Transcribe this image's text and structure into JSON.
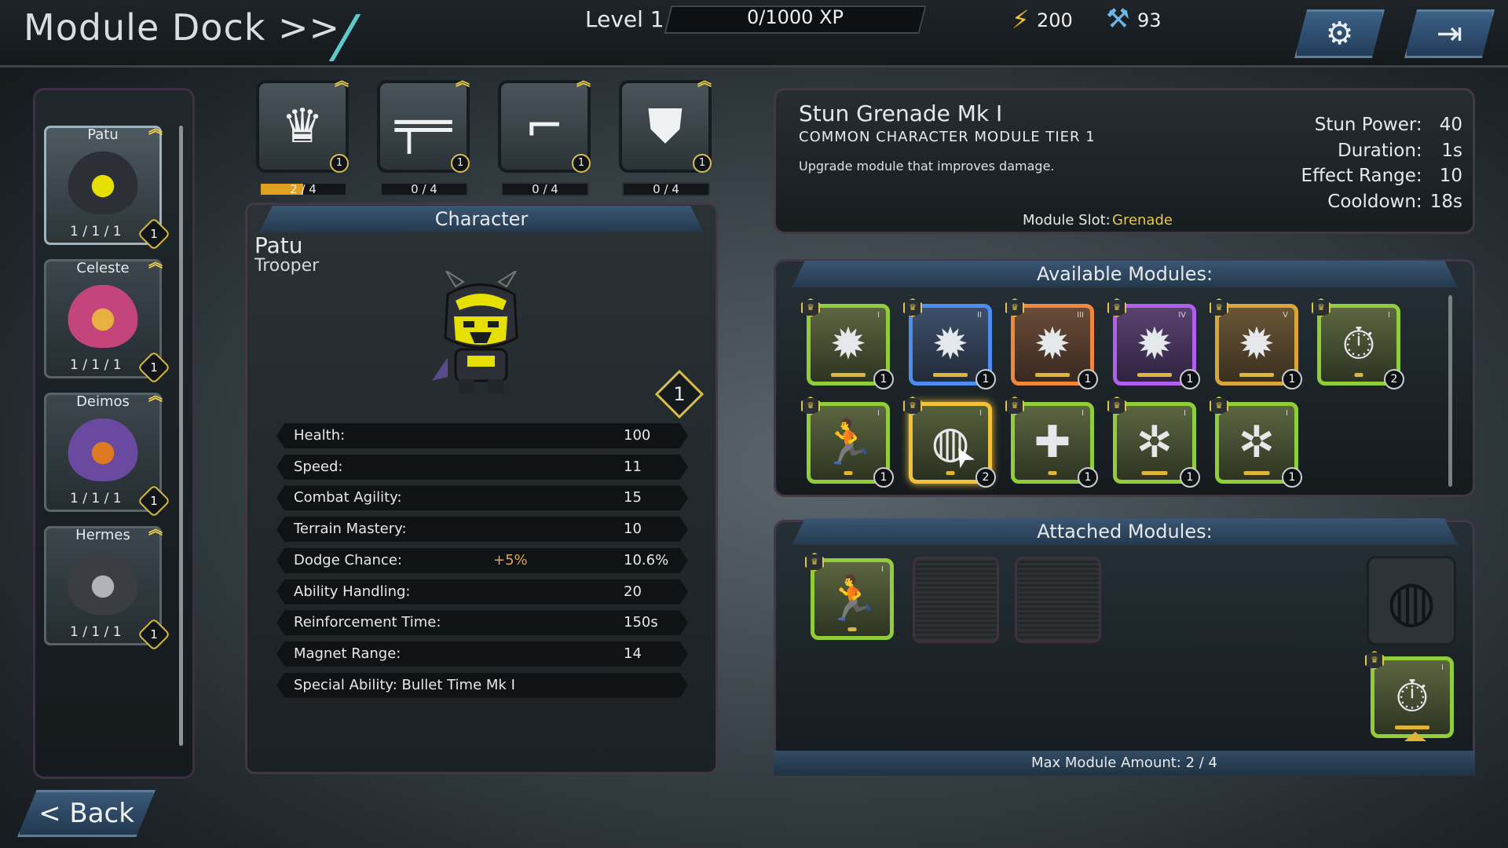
{
  "header": {
    "title": "Module Dock >>",
    "level": "Level 1",
    "xp": "0/1000 XP",
    "energy": "200",
    "parts": "93",
    "settings_icon": "⚙",
    "exit_icon": "⇥"
  },
  "roster": [
    {
      "name": "Patu",
      "stats": "1 / 1 / 1",
      "level": "1",
      "selected": true
    },
    {
      "name": "Celeste",
      "stats": "1 / 1 / 1",
      "level": "1",
      "selected": false
    },
    {
      "name": "Deimos",
      "stats": "1 / 1 / 1",
      "level": "1",
      "selected": false
    },
    {
      "name": "Hermes",
      "stats": "1 / 1 / 1",
      "level": "1",
      "selected": false
    }
  ],
  "slots": [
    {
      "icon": "helmet-icon",
      "glyph": "♛",
      "level": "1",
      "progress": "2 / 4",
      "fill": 0.5
    },
    {
      "icon": "rifle-icon",
      "glyph": "╤═",
      "level": "1",
      "progress": "0 / 4",
      "fill": 0
    },
    {
      "icon": "pistol-icon",
      "glyph": "⌐",
      "level": "1",
      "progress": "0 / 4",
      "fill": 0
    },
    {
      "icon": "shield-icon",
      "glyph": "⛊",
      "level": "1",
      "progress": "0 / 4",
      "fill": 0
    }
  ],
  "character": {
    "header": "Character",
    "name": "Patu",
    "class": "Trooper",
    "level": "1",
    "stats": [
      {
        "label": "Health:",
        "bonus": "",
        "value": "100"
      },
      {
        "label": "Speed:",
        "bonus": "",
        "value": "11"
      },
      {
        "label": "Combat Agility:",
        "bonus": "",
        "value": "15"
      },
      {
        "label": "Terrain Mastery:",
        "bonus": "",
        "value": "10"
      },
      {
        "label": "Dodge Chance:",
        "bonus": "+5%",
        "value": "10.6%"
      },
      {
        "label": "Ability Handling:",
        "bonus": "",
        "value": "20"
      },
      {
        "label": "Reinforcement Time:",
        "bonus": "",
        "value": "150s"
      },
      {
        "label": "Magnet Range:",
        "bonus": "",
        "value": "14"
      },
      {
        "label": "Special Ability: Bullet Time Mk I",
        "bonus": "",
        "value": ""
      }
    ]
  },
  "module_info": {
    "name": "Stun Grenade Mk I",
    "tier": "COMMON CHARACTER MODULE TIER 1",
    "description": "Upgrade module that improves damage.",
    "slot_label": "Module Slot:",
    "slot_value": "Grenade",
    "stats": [
      {
        "label": "Stun Power:",
        "value": "40"
      },
      {
        "label": "Duration:",
        "value": "1s"
      },
      {
        "label": "Effect Range:",
        "value": "10"
      },
      {
        "label": "Cooldown:",
        "value": "18s"
      }
    ]
  },
  "available": {
    "header": "Available Modules:",
    "modules": [
      {
        "icon": "burst-icon",
        "glyph": "✹",
        "grade": "green",
        "tier": "I",
        "count": "1",
        "pips": 4
      },
      {
        "icon": "burst-icon",
        "glyph": "✹",
        "grade": "blue",
        "tier": "II",
        "count": "1",
        "pips": 4
      },
      {
        "icon": "burst-icon",
        "glyph": "✹",
        "grade": "orange",
        "tier": "III",
        "count": "1",
        "pips": 4
      },
      {
        "icon": "burst-icon",
        "glyph": "✹",
        "grade": "purple",
        "tier": "IV",
        "count": "1",
        "pips": 4
      },
      {
        "icon": "burst-icon",
        "glyph": "✹",
        "grade": "gold",
        "tier": "V",
        "count": "1",
        "pips": 4
      },
      {
        "icon": "cooldown-icon",
        "glyph": "⏱",
        "grade": "green",
        "tier": "I",
        "count": "2",
        "pips": 1
      },
      {
        "icon": "sprint-icon",
        "glyph": "🏃",
        "grade": "green",
        "tier": "I",
        "count": "1",
        "pips": 1
      },
      {
        "icon": "grenade-icon",
        "glyph": "◍",
        "grade": "sel",
        "tier": "I",
        "count": "2",
        "pips": 1
      },
      {
        "icon": "heal-icon",
        "glyph": "✚",
        "grade": "green",
        "tier": "I",
        "count": "1",
        "pips": 1
      },
      {
        "icon": "wolf-icon",
        "glyph": "✲",
        "grade": "green",
        "tier": "I",
        "count": "1",
        "pips": 3
      },
      {
        "icon": "wolf-icon",
        "glyph": "✲",
        "grade": "green",
        "tier": "I",
        "count": "1",
        "pips": 3
      }
    ]
  },
  "attached": {
    "header": "Attached Modules:",
    "footer": "Max Module Amount: 2 / 4",
    "modules": [
      {
        "icon": "sprint-icon",
        "glyph": "🏃",
        "grade": "green",
        "tier": "I",
        "pips": 1
      }
    ],
    "grenade_slot_icon": "◍",
    "grenade_module": {
      "icon": "stopwatch-icon",
      "glyph": "⏱",
      "grade": "green",
      "tier": "I",
      "pips": 4
    }
  },
  "back_label": "< Back",
  "colors": {
    "accent": "#f2c23a",
    "panel_border": "#433846",
    "header_blue": "#3b5673"
  }
}
